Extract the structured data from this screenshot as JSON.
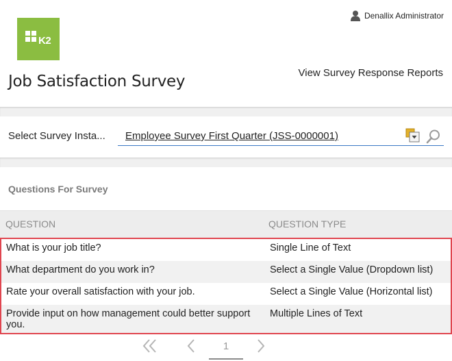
{
  "app": {
    "logo_text": "K2",
    "user_name": "Denallix Administrator"
  },
  "header": {
    "title": "Job Satisfaction Survey",
    "report_link": "View Survey Response Reports"
  },
  "selector": {
    "label": "Select Survey Insta...",
    "value": "Employee Survey First Quarter (JSS-0000001)"
  },
  "questions": {
    "section_title": "Questions For Survey",
    "columns": [
      "QUESTION",
      "QUESTION TYPE"
    ],
    "rows": [
      {
        "question": "What is your job title?",
        "type": "Single Line of Text"
      },
      {
        "question": "What department do you work in?",
        "type": "Select a Single Value (Dropdown list)"
      },
      {
        "question": "Rate your overall satisfaction with your job.",
        "type": "Select a Single Value (Horizontal list)"
      },
      {
        "question": "Provide input on how management could better support you.",
        "type": "Multiple Lines of Text"
      }
    ]
  },
  "pager": {
    "page": "1",
    "icons": [
      "first-page-icon",
      "prev-page-icon",
      "next-page-icon"
    ]
  },
  "colors": {
    "brand": "#8bbd41",
    "highlight_border": "#e0454f",
    "field_underline": "#3a78c4"
  }
}
